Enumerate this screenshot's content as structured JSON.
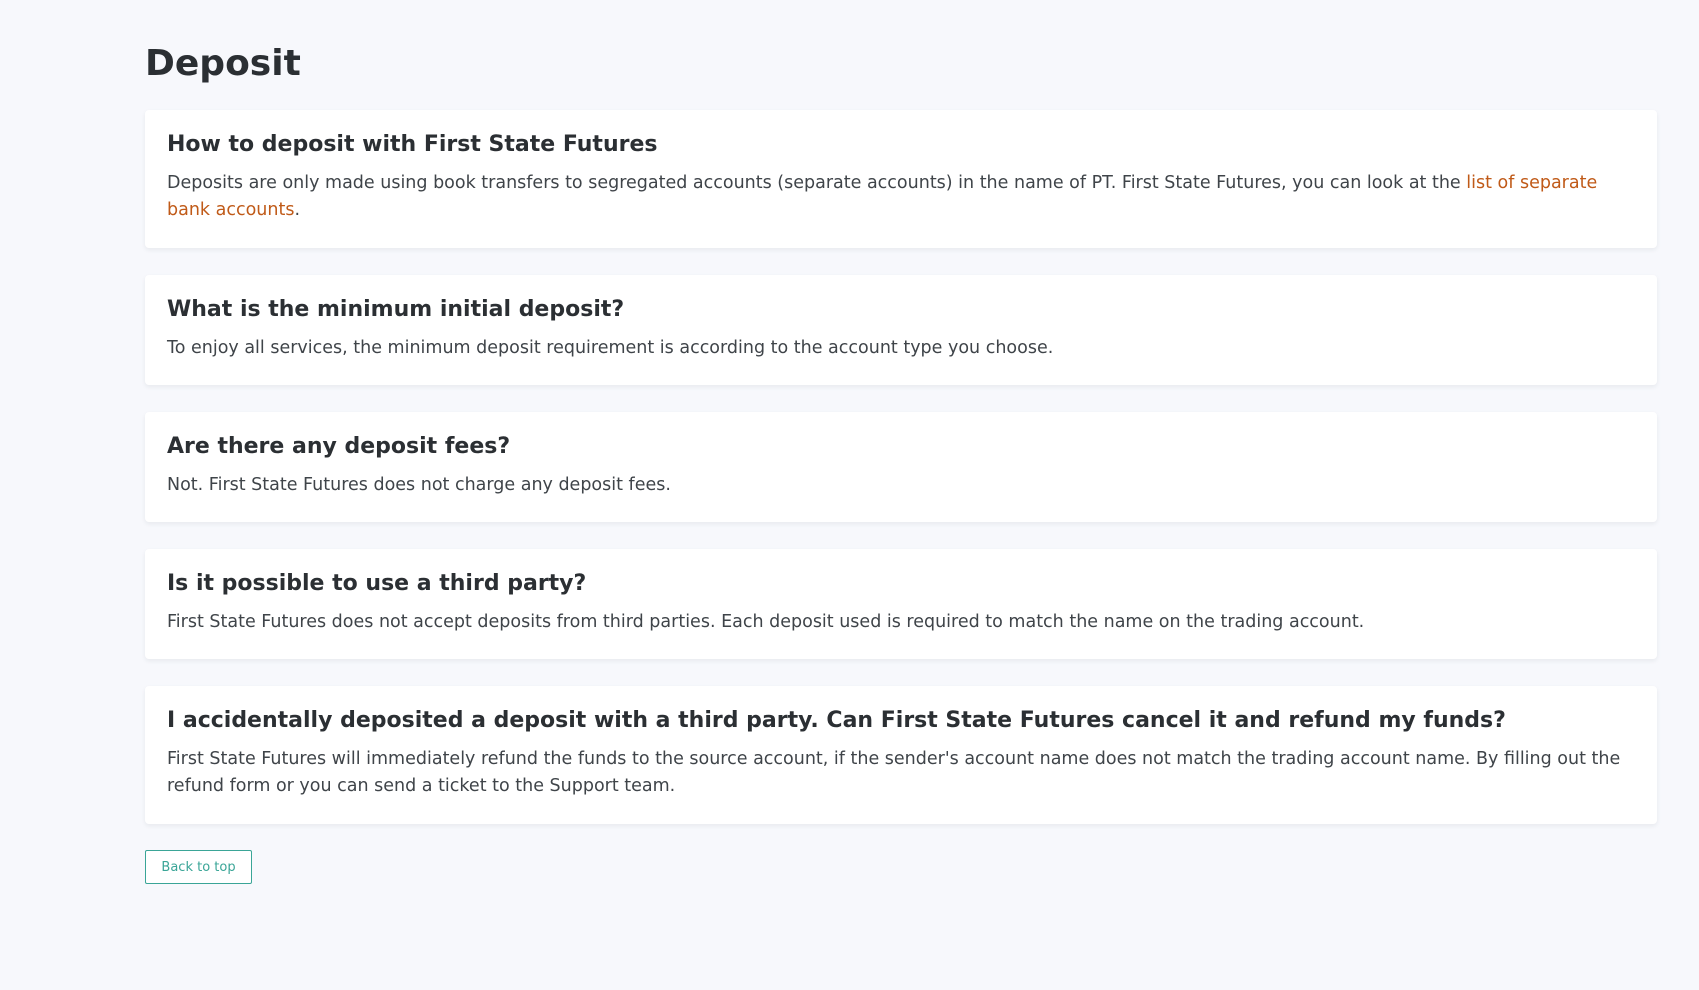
{
  "page": {
    "title": "Deposit"
  },
  "faq": [
    {
      "question": "How to deposit with First State Futures",
      "answer_before_link": "Deposits are only made using book transfers to segregated accounts (separate accounts) in the name of PT. First State Futures, you can look at the ",
      "link_text": "list of separate bank accounts",
      "answer_after_link": "."
    },
    {
      "question": "What is the minimum initial deposit?",
      "answer": "To enjoy all services, the minimum deposit requirement is according to the account type you choose."
    },
    {
      "question": "Are there any deposit fees?",
      "answer": "Not. First State Futures does not charge any deposit fees."
    },
    {
      "question": "Is it possible to use a third party?",
      "answer": "First State Futures does not accept deposits from third parties. Each deposit used is required to match the name on the trading account."
    },
    {
      "question": "I accidentally deposited a deposit with a third party. Can First State Futures cancel it and refund my funds?",
      "answer": "First State Futures will immediately refund the funds to the source account, if the sender's account name does not match the trading account name. By filling out the refund form or you can send a ticket to the Support team."
    }
  ],
  "back_to_top_label": "Back to top",
  "colors": {
    "background": "#f7f8fc",
    "card": "#ffffff",
    "link": "#c05a18",
    "button_accent": "#3aa597"
  }
}
